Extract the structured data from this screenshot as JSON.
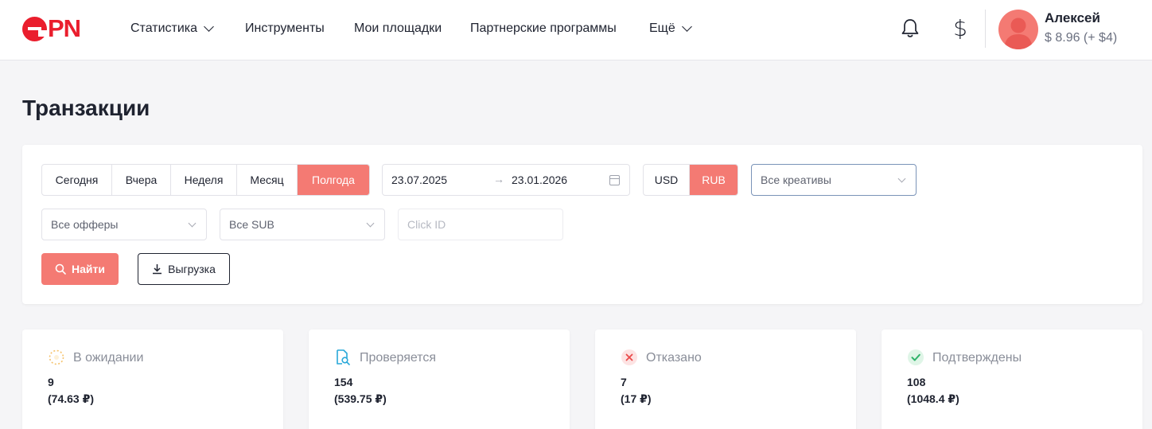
{
  "logo": {
    "text": "PN"
  },
  "nav": [
    {
      "label": "Статистика",
      "dropdown": true
    },
    {
      "label": "Инструменты",
      "dropdown": false
    },
    {
      "label": "Мои площадки",
      "dropdown": false
    },
    {
      "label": "Партнерские программы",
      "dropdown": false
    },
    {
      "label": "Ещё",
      "dropdown": true
    }
  ],
  "header": {
    "notifications_icon": "bell-icon",
    "currency_icon": "$",
    "user": {
      "name": "Алексей",
      "balance": "$ 8.96 (+ $4)"
    }
  },
  "page": {
    "title": "Транзакции"
  },
  "filters": {
    "periods": [
      "Сегодня",
      "Вчера",
      "Неделя",
      "Месяц",
      "Полгода"
    ],
    "active_period": "Полгода",
    "date_from": "23.07.2025",
    "date_arrow": "→",
    "date_to": "23.01.2026",
    "currencies": [
      "USD",
      "RUB"
    ],
    "active_currency": "RUB",
    "creatives_select": "Все креативы",
    "offers_select": "Все офферы",
    "sub_select": "Все SUB",
    "click_id_placeholder": "Click ID",
    "find_label": "Найти",
    "export_label": "Выгрузка"
  },
  "stats": [
    {
      "label": "В ожидании",
      "count": "9",
      "sum": "(74.63 ₽)",
      "icon": "pending-icon",
      "color": "#f5c26b"
    },
    {
      "label": "Проверяется",
      "count": "154",
      "sum": "(539.75 ₽)",
      "icon": "search-document-icon",
      "color": "#29a8d9"
    },
    {
      "label": "Отказано",
      "count": "7",
      "sum": "(17 ₽)",
      "icon": "cross-icon",
      "color": "#ea4b4b"
    },
    {
      "label": "Подтверждены",
      "count": "108",
      "sum": "(1048.4 ₽)",
      "icon": "check-icon",
      "color": "#2fb36a"
    }
  ],
  "colors": {
    "brand": "#ea1e2d",
    "accent": "#f47a73"
  }
}
